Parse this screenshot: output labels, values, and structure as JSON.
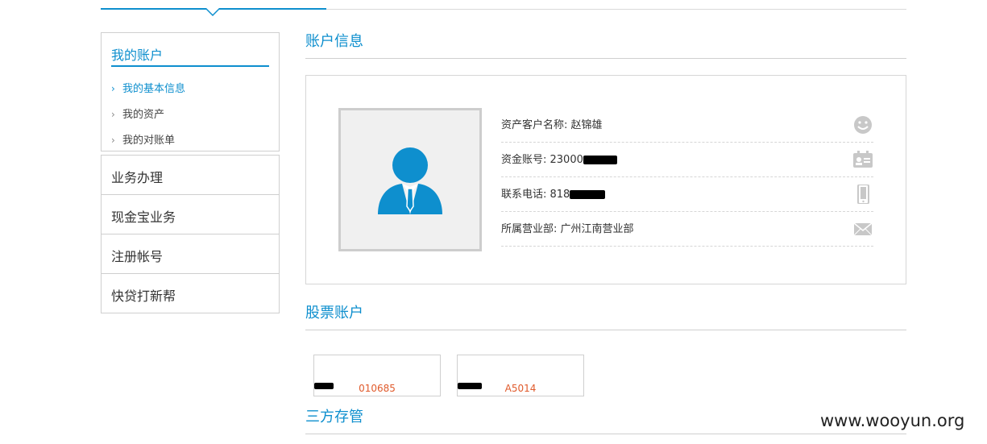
{
  "sidebar": {
    "account_heading": "我的账户",
    "sub_items": [
      "我的基本信息",
      "我的资产",
      "我的对账单"
    ],
    "menu_items": [
      "业务办理",
      "现金宝业务",
      "注册帐号",
      "快贷打新帮"
    ]
  },
  "sections": {
    "account_info": "账户信息",
    "stock_accounts": "股票账户",
    "third_party": "三方存管"
  },
  "account_info": {
    "customer_name": "资产客户名称: 赵锦雄",
    "fund_account": "资金账号: 23000",
    "phone": "联系电话: 818",
    "branch": "所属营业部: 广州江南营业部"
  },
  "stock_accounts": [
    "010685",
    "A5014"
  ],
  "watermark": "www.wooyun.org",
  "colors": {
    "accent": "#0e8fce",
    "stock_text": "#e05a2b",
    "avatar": "#0e8fce",
    "icons": "#c8c8c8"
  },
  "icons": [
    "chevron-right-icon",
    "smiley-icon",
    "id-card-icon",
    "phone-icon",
    "mail-icon",
    "user-avatar-icon"
  ]
}
